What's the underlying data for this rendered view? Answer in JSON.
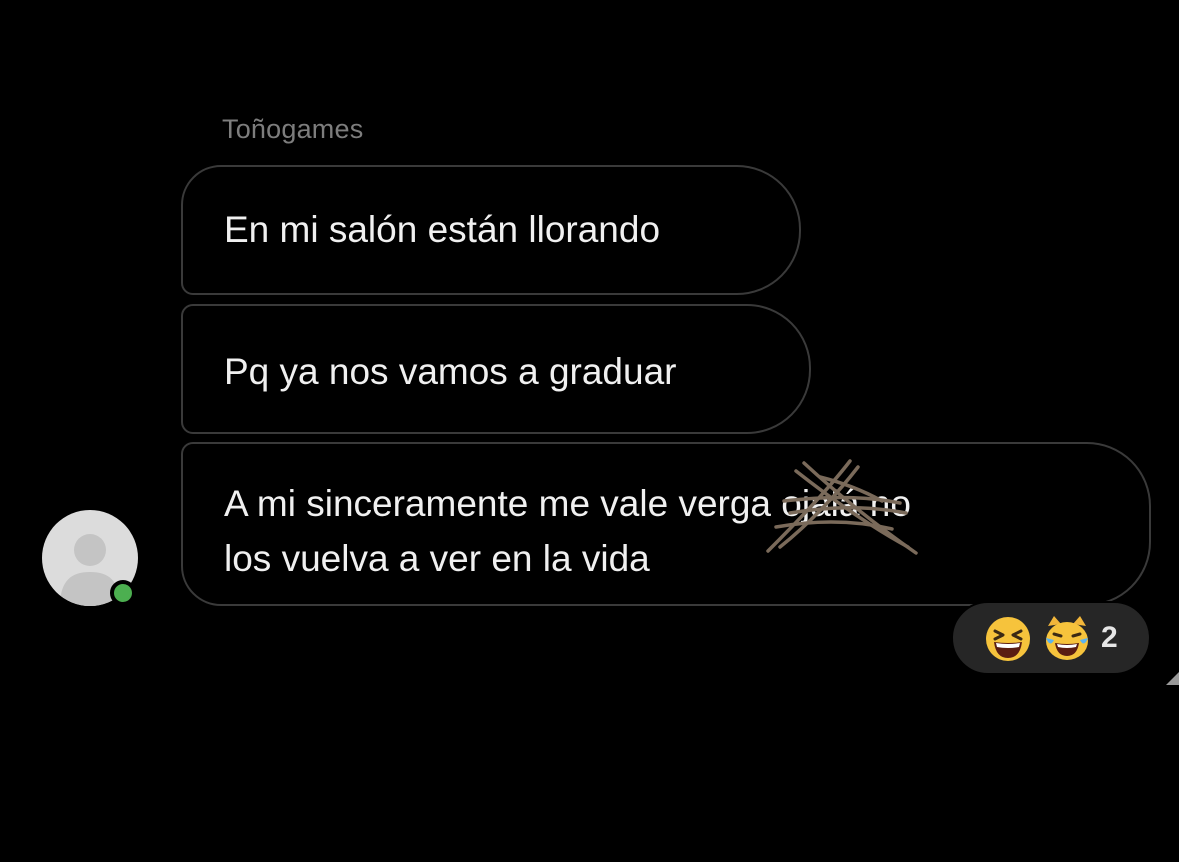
{
  "conversation": {
    "sender_name": "Toñogames",
    "messages": [
      {
        "lines": [
          "En mi salón están llorando"
        ]
      },
      {
        "lines": [
          "Pq ya nos vamos a graduar"
        ]
      },
      {
        "lines": [
          "A mi sinceramente me vale verga ojalá no",
          "los vuelva a ver en la vida"
        ]
      }
    ],
    "reactions": {
      "emojis": [
        "grinning-squinting-face",
        "cat-tears-of-joy"
      ],
      "count": "2"
    }
  },
  "avatar": {
    "status": "online",
    "status_color": "#4caf50"
  },
  "overlay": {
    "scribble_color": "#7a6a5a"
  }
}
